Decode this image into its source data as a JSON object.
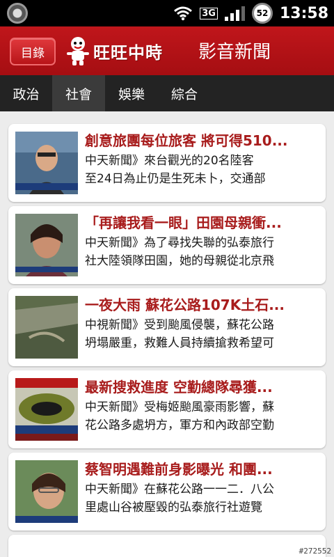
{
  "status_bar": {
    "network": "3G",
    "battery": "52",
    "time": "13:58"
  },
  "header": {
    "menu_label": "目錄",
    "logo_text": "旺旺中時",
    "title": "影音新聞"
  },
  "tabs": [
    {
      "label": "政治",
      "active": false
    },
    {
      "label": "社會",
      "active": true
    },
    {
      "label": "娛樂",
      "active": false
    },
    {
      "label": "綜合",
      "active": false
    }
  ],
  "news": [
    {
      "title": "創意旅團每位旅客 將可得510...",
      "line1": "中天新聞》來台觀光的20名陸客",
      "line2": "至24日為止仍是生死未卜，交通部"
    },
    {
      "title": "「再讓我看一眼」田園母親衝...",
      "line1": "中天新聞》為了尋找失聯的弘泰旅行",
      "line2": "社大陸領隊田園，她的母親從北京飛"
    },
    {
      "title": "一夜大雨 蘇花公路107K土石...",
      "line1": "中視新聞》受到颱風侵襲，蘇花公路",
      "line2": "坍塌嚴重，救難人員持續搶救希望可"
    },
    {
      "title": "最新搜救進度 空勤總隊尋獲...",
      "line1": "中天新聞》受梅姬颱風豪雨影響，蘇",
      "line2": "花公路多處坍方，軍方和內政部空勤"
    },
    {
      "title": "蔡智明遇難前身影曝光 和團...",
      "line1": "中天新聞》在蘇花公路一一二．八公",
      "line2": "里處山谷被壓毀的弘泰旅行社遊覽"
    }
  ],
  "watermark": "#272552"
}
